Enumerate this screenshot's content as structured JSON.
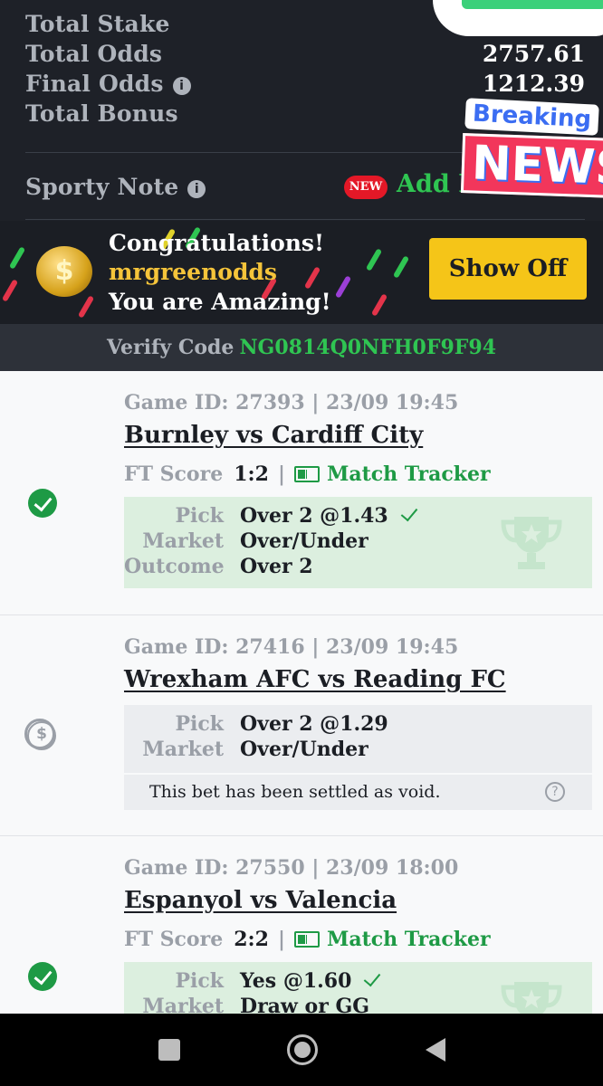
{
  "summary": {
    "total_stake_label": "Total Stake",
    "total_odds_label": "Total Odds",
    "total_odds_value": "2757.61",
    "final_odds_label": "Final Odds",
    "final_odds_value": "1212.39",
    "total_bonus_label": "Total Bonus",
    "info_glyph": "i"
  },
  "note": {
    "label": "Sporty Note",
    "new_badge": "NEW",
    "add_label": "Add Private Note"
  },
  "sticker": {
    "breaking": "Breaking",
    "news": "NEWS"
  },
  "congrats": {
    "coin_glyph": "$",
    "line1": "Congratulations!",
    "username": "mrgreenodds",
    "line3": "You are Amazing!",
    "button": "Show Off"
  },
  "verify": {
    "label": "Verify Code",
    "code": "NG0814Q0NFH0F9F94"
  },
  "games": [
    {
      "game_id": "Game ID: 27393 | 23/09 19:45",
      "match": "Burnley vs Cardiff City",
      "ft_label": "FT Score",
      "ft_score": "1:2",
      "separator": "|",
      "tracker_label": "Match Tracker",
      "status": "won",
      "pick_label": "Pick",
      "pick_value": "Over 2 @1.43",
      "market_label": "Market",
      "market_value": "Over/Under",
      "outcome_label": "Outcome",
      "outcome_value": "Over 2"
    },
    {
      "game_id": "Game ID: 27416 | 23/09 19:45",
      "match": "Wrexham AFC vs Reading FC",
      "status": "void",
      "pick_label": "Pick",
      "pick_value": "Over 2 @1.29",
      "market_label": "Market",
      "market_value": "Over/Under",
      "void_note": "This bet has been settled as void.",
      "help_glyph": "?"
    },
    {
      "game_id": "Game ID: 27550 | 23/09 18:00",
      "match": "Espanyol vs Valencia",
      "ft_label": "FT Score",
      "ft_score": "2:2",
      "separator": "|",
      "tracker_label": "Match Tracker",
      "status": "won",
      "pick_label": "Pick",
      "pick_value": "Yes @1.60",
      "market_label": "Market",
      "market_value": "Draw or GG"
    }
  ],
  "colors": {
    "accent_green": "#2fc552",
    "won_green": "#1e9a45",
    "cta_yellow": "#f5c518",
    "new_red": "#e41827",
    "dark_bg": "#1e2128"
  },
  "icons": [
    "info-icon",
    "coin-icon",
    "won-check-icon",
    "void-icon",
    "tracker-icon",
    "trophy-icon",
    "help-icon",
    "nav-recents-icon",
    "nav-home-icon",
    "nav-back-icon"
  ]
}
